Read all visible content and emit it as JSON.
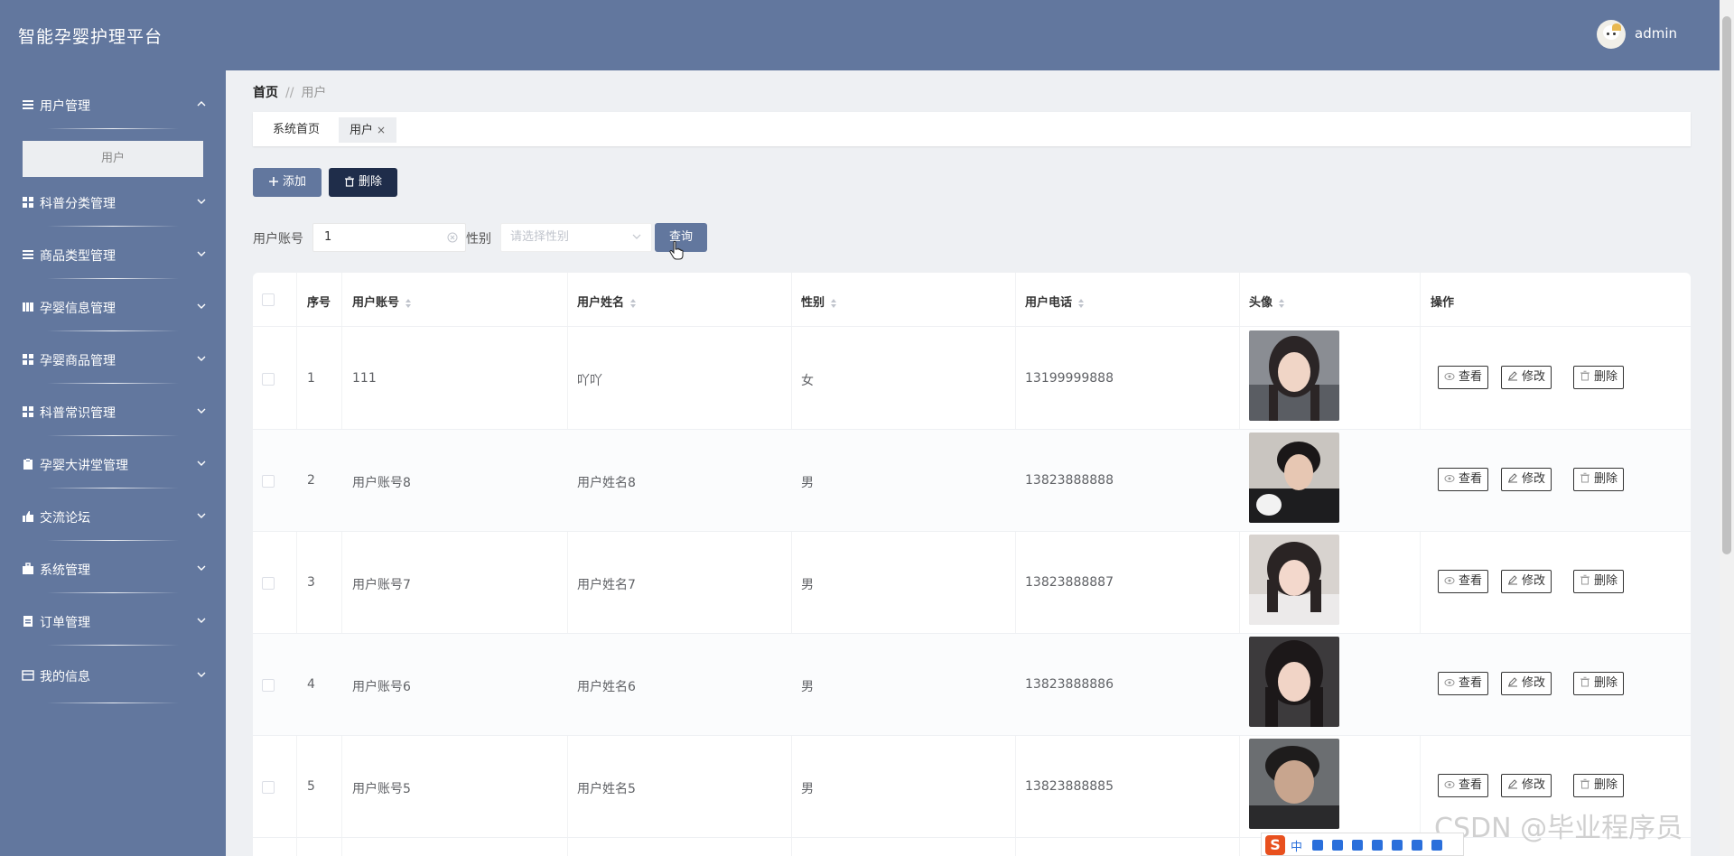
{
  "app": {
    "title": "智能孕婴护理平台",
    "user_name": "admin"
  },
  "sidebar": {
    "items": [
      {
        "label": "用户管理",
        "icon": "menu-icon",
        "expanded": true
      },
      {
        "label": "科普分类管理",
        "icon": "grid-icon"
      },
      {
        "label": "商品类型管理",
        "icon": "menu-icon"
      },
      {
        "label": "孕婴信息管理",
        "icon": "book-icon"
      },
      {
        "label": "孕婴商品管理",
        "icon": "grid-icon"
      },
      {
        "label": "科普常识管理",
        "icon": "grid-icon"
      },
      {
        "label": "孕婴大讲堂管理",
        "icon": "clipboard-icon"
      },
      {
        "label": "交流论坛",
        "icon": "thumbs-up-icon"
      },
      {
        "label": "系统管理",
        "icon": "briefcase-icon"
      },
      {
        "label": "订单管理",
        "icon": "document-icon"
      },
      {
        "label": "我的信息",
        "icon": "card-icon"
      }
    ],
    "submenu": {
      "label": "用户"
    }
  },
  "breadcrumb": {
    "home": "首页",
    "separator": "//",
    "current": "用户"
  },
  "tabs": [
    {
      "label": "系统首页"
    },
    {
      "label": "用户",
      "close": "×",
      "active": true
    }
  ],
  "toolbar": {
    "add_label": "添加",
    "delete_label": "删除"
  },
  "search": {
    "account_label": "用户账号",
    "account_value": "1",
    "gender_label": "性别",
    "gender_placeholder": "请选择性别",
    "search_label": "查询"
  },
  "table": {
    "headers": {
      "index": "序号",
      "account": "用户账号",
      "name": "用户姓名",
      "gender": "性别",
      "phone": "用户电话",
      "avatar": "头像",
      "actions": "操作"
    },
    "action_labels": {
      "view": "查看",
      "edit": "修改",
      "delete": "删除"
    },
    "rows": [
      {
        "index": "1",
        "account": "111",
        "name": "吖吖",
        "gender": "女",
        "phone": "13199999888"
      },
      {
        "index": "2",
        "account": "用户账号8",
        "name": "用户姓名8",
        "gender": "男",
        "phone": "13823888888"
      },
      {
        "index": "3",
        "account": "用户账号7",
        "name": "用户姓名7",
        "gender": "男",
        "phone": "13823888887"
      },
      {
        "index": "4",
        "account": "用户账号6",
        "name": "用户姓名6",
        "gender": "男",
        "phone": "13823888886"
      },
      {
        "index": "5",
        "account": "用户账号5",
        "name": "用户姓名5",
        "gender": "男",
        "phone": "13823888885"
      }
    ]
  },
  "watermark": "CSDN @毕业程序员",
  "ime": {
    "logo": "S",
    "mode": "中"
  },
  "colors": {
    "primary": "#62779e",
    "dark": "#1f2d4a",
    "background": "#eef0f3"
  }
}
